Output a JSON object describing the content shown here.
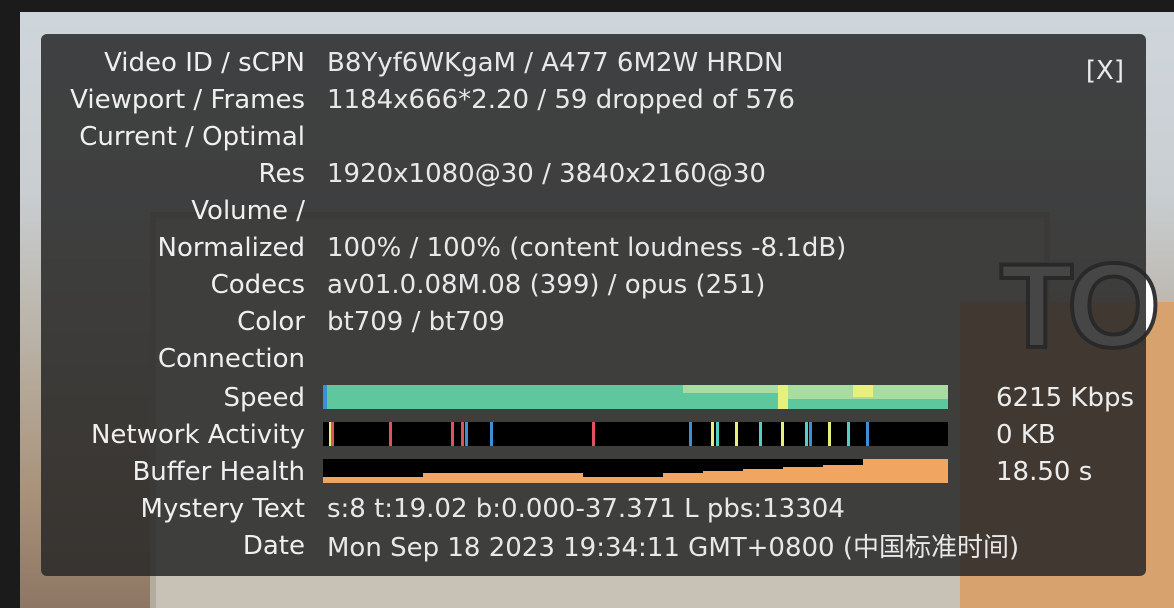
{
  "close_label": "[X]",
  "rows": [
    {
      "label": "Video ID / sCPN",
      "value": "B8Yyf6WKgaM / A477 6M2W HRDN"
    },
    {
      "label": "Viewport / Frames",
      "value": "1184x666*2.20 / 59 dropped of 576"
    },
    {
      "label": "Current / Optimal",
      "value": ""
    },
    {
      "label": "Res",
      "value": "1920x1080@30 / 3840x2160@30"
    },
    {
      "label": "Volume /",
      "value": ""
    },
    {
      "label": "Normalized",
      "value": "100% / 100% (content loudness -8.1dB)"
    },
    {
      "label": "Codecs",
      "value": "av01.0.08M.08 (399) / opus (251)"
    },
    {
      "label": "Color",
      "value": "bt709 / bt709"
    },
    {
      "label": "Connection",
      "value": ""
    },
    {
      "label": "Speed",
      "value": "6215 Kbps"
    },
    {
      "label": "Network Activity",
      "value": "0 KB"
    },
    {
      "label": "Buffer Health",
      "value": "18.50 s"
    },
    {
      "label": "Mystery Text",
      "value": "s:8 t:19.02 b:0.000-37.371 L pbs:13304"
    },
    {
      "label": "Date",
      "value": "Mon Sep 18 2023 19:34:11 GMT+0800 (中国标准时间)"
    }
  ],
  "background_text": "TO",
  "colors": {
    "speed_main": "#5fc79d",
    "speed_light": "#a9dca0",
    "speed_yellow": "#e6f07a",
    "net_red": "#e0515f",
    "net_blue": "#3a8fd6",
    "net_teal": "#55d0c0",
    "net_yellow": "#f2e57a",
    "buffer_orange": "#f0a560"
  }
}
